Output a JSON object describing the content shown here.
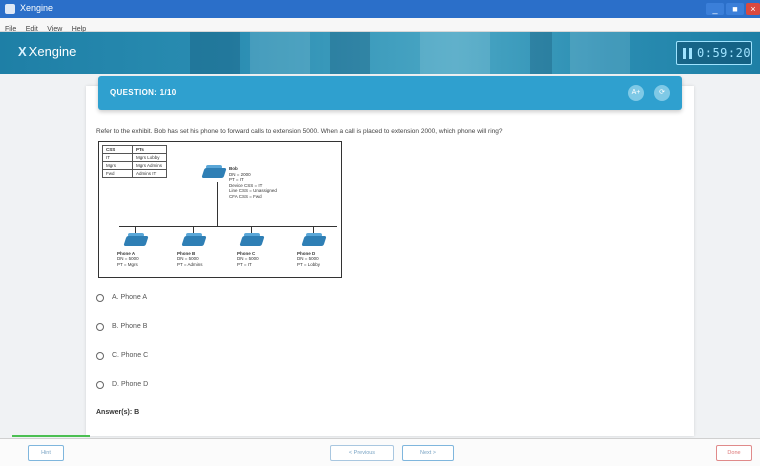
{
  "window": {
    "title": "Xengine",
    "min": "_",
    "max": "■",
    "close": "×"
  },
  "menu": [
    "File",
    "Edit",
    "View",
    "Help"
  ],
  "header": {
    "logo_mark": "X",
    "logo_text": "Xengine",
    "timer": "0:59:20"
  },
  "question": {
    "title": "QUESTION: 1/10",
    "icon_a": "A+",
    "icon_b": "⟳",
    "text": "Refer to the exhibit. Bob has set his phone to forward calls to extension 5000. When a call is placed to extension 2000, which phone will ring?"
  },
  "exhibit": {
    "table": {
      "headers": [
        "CSS",
        "PTs"
      ],
      "rows": [
        [
          "IT",
          "Mgrs Lobby"
        ],
        [
          "Mgrs",
          "Mgrs Admins"
        ],
        [
          "Fwd",
          "Admins IT"
        ]
      ]
    },
    "bob": {
      "name": "Bob",
      "lines": [
        "DN = 2000",
        "PT = IT",
        "Device CSS = IT",
        "Line CSS = Unassigned",
        "CFA CSS = Fwd"
      ]
    },
    "phones": [
      {
        "name": "Phone A",
        "dn": "DN = 5000",
        "pt": "PT = Mgrs"
      },
      {
        "name": "Phone B",
        "dn": "DN = 5000",
        "pt": "PT = Admins"
      },
      {
        "name": "Phone C",
        "dn": "DN = 5000",
        "pt": "PT = IT"
      },
      {
        "name": "Phone D",
        "dn": "DN = 5000",
        "pt": "PT = Lobby"
      }
    ]
  },
  "options": [
    {
      "label": "A. Phone A"
    },
    {
      "label": "B. Phone B"
    },
    {
      "label": "C. Phone C"
    },
    {
      "label": "D. Phone D"
    }
  ],
  "answer": "Answer(s): B",
  "footer": {
    "left_button": "Hint",
    "previous_button": "< Previous",
    "next_button": "Next >",
    "done_button": "Done"
  }
}
